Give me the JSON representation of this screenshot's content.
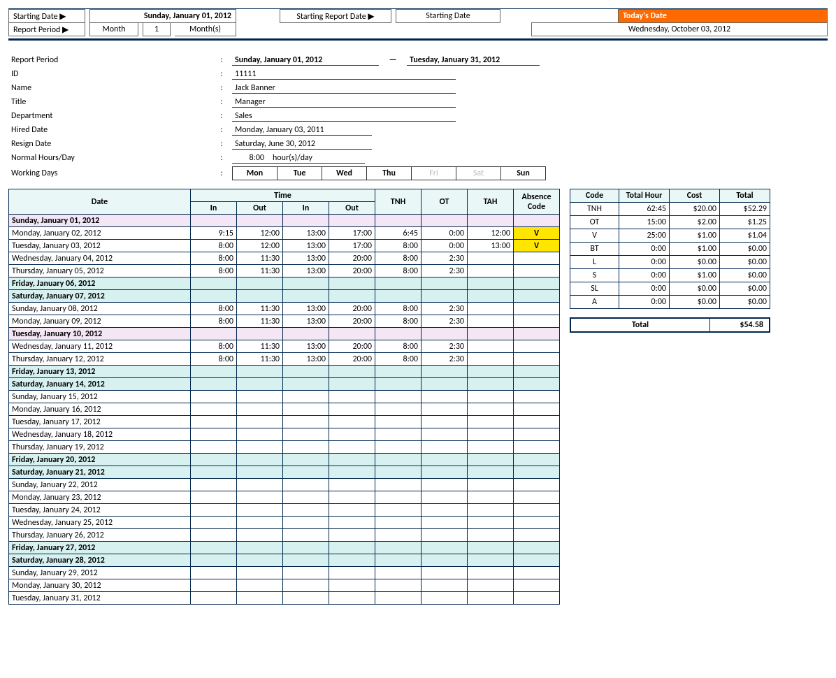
{
  "top": {
    "starting_date_label": "Starting Date ▶",
    "starting_date_value": "Sunday, January 01, 2012",
    "report_period_label": "Report Period ▶",
    "report_period_unit1": "Month",
    "report_period_qty": "1",
    "report_period_unit2": "Month(s)",
    "starting_report_date_label": "Starting Report Date ▶",
    "starting_report_date_value": "Starting Date",
    "today_header": "Today's Date",
    "today_value": "Wednesday, October 03, 2012"
  },
  "info": {
    "report_period_label": "Report Period",
    "report_period_from": "Sunday, January 01, 2012",
    "report_period_dash": "—",
    "report_period_to": "Tuesday, January 31, 2012",
    "id_label": "ID",
    "id_value": "11111",
    "name_label": "Name",
    "name_value": "Jack Banner",
    "title_label": "Title",
    "title_value": "Manager",
    "dept_label": "Department",
    "dept_value": "Sales",
    "hired_label": "Hired Date",
    "hired_value": "Monday, January 03, 2011",
    "resign_label": "Resign Date",
    "resign_value": "Saturday, June 30, 2012",
    "normal_label": "Normal Hours/Day",
    "normal_value": "8:00",
    "normal_unit": "hour(s)/day",
    "working_days_label": "Working Days",
    "days": [
      {
        "lbl": "Mon",
        "active": true
      },
      {
        "lbl": "Tue",
        "active": true
      },
      {
        "lbl": "Wed",
        "active": true
      },
      {
        "lbl": "Thu",
        "active": true
      },
      {
        "lbl": "Fri",
        "active": false
      },
      {
        "lbl": "Sat",
        "active": false
      },
      {
        "lbl": "Sun",
        "active": true
      }
    ]
  },
  "tt_headers": {
    "date": "Date",
    "time": "Time",
    "in": "In",
    "out": "Out",
    "tnh": "TNH",
    "ot": "OT",
    "tah": "TAH",
    "absence": "Absence Code"
  },
  "tt_rows": [
    {
      "type": "pink",
      "date": "Sunday, January 01, 2012"
    },
    {
      "type": "data",
      "date": "Monday, January 02, 2012",
      "in1": "9:15",
      "out1": "12:00",
      "in2": "13:00",
      "out2": "17:00",
      "tnh": "6:45",
      "ot": "0:00",
      "tah": "12:00",
      "code": "V",
      "hl": true
    },
    {
      "type": "data",
      "date": "Tuesday, January 03, 2012",
      "in1": "8:00",
      "out1": "12:00",
      "in2": "13:00",
      "out2": "17:00",
      "tnh": "8:00",
      "ot": "0:00",
      "tah": "13:00",
      "code": "V",
      "hl": true
    },
    {
      "type": "data",
      "date": "Wednesday, January 04, 2012",
      "in1": "8:00",
      "out1": "11:30",
      "in2": "13:00",
      "out2": "20:00",
      "tnh": "8:00",
      "ot": "2:30"
    },
    {
      "type": "data",
      "date": "Thursday, January 05, 2012",
      "in1": "8:00",
      "out1": "11:30",
      "in2": "13:00",
      "out2": "20:00",
      "tnh": "8:00",
      "ot": "2:30"
    },
    {
      "type": "blue",
      "date": "Friday, January 06, 2012"
    },
    {
      "type": "blue",
      "date": "Saturday, January 07, 2012"
    },
    {
      "type": "data",
      "date": "Sunday, January 08, 2012",
      "in1": "8:00",
      "out1": "11:30",
      "in2": "13:00",
      "out2": "20:00",
      "tnh": "8:00",
      "ot": "2:30"
    },
    {
      "type": "data",
      "date": "Monday, January 09, 2012",
      "in1": "8:00",
      "out1": "11:30",
      "in2": "13:00",
      "out2": "20:00",
      "tnh": "8:00",
      "ot": "2:30"
    },
    {
      "type": "pink",
      "date": "Tuesday, January 10, 2012"
    },
    {
      "type": "data",
      "date": "Wednesday, January 11, 2012",
      "in1": "8:00",
      "out1": "11:30",
      "in2": "13:00",
      "out2": "20:00",
      "tnh": "8:00",
      "ot": "2:30"
    },
    {
      "type": "data",
      "date": "Thursday, January 12, 2012",
      "in1": "8:00",
      "out1": "11:30",
      "in2": "13:00",
      "out2": "20:00",
      "tnh": "8:00",
      "ot": "2:30"
    },
    {
      "type": "blue",
      "date": "Friday, January 13, 2012"
    },
    {
      "type": "blue",
      "date": "Saturday, January 14, 2012"
    },
    {
      "type": "data",
      "date": "Sunday, January 15, 2012"
    },
    {
      "type": "data",
      "date": "Monday, January 16, 2012"
    },
    {
      "type": "data",
      "date": "Tuesday, January 17, 2012"
    },
    {
      "type": "data",
      "date": "Wednesday, January 18, 2012"
    },
    {
      "type": "data",
      "date": "Thursday, January 19, 2012"
    },
    {
      "type": "blue",
      "date": "Friday, January 20, 2012"
    },
    {
      "type": "blue",
      "date": "Saturday, January 21, 2012"
    },
    {
      "type": "data",
      "date": "Sunday, January 22, 2012"
    },
    {
      "type": "data",
      "date": "Monday, January 23, 2012"
    },
    {
      "type": "data",
      "date": "Tuesday, January 24, 2012"
    },
    {
      "type": "data",
      "date": "Wednesday, January 25, 2012"
    },
    {
      "type": "data",
      "date": "Thursday, January 26, 2012"
    },
    {
      "type": "blue",
      "date": "Friday, January 27, 2012"
    },
    {
      "type": "blue",
      "date": "Saturday, January 28, 2012"
    },
    {
      "type": "data",
      "date": "Sunday, January 29, 2012"
    },
    {
      "type": "data",
      "date": "Monday, January 30, 2012"
    },
    {
      "type": "data",
      "date": "Tuesday, January 31, 2012"
    }
  ],
  "summary": {
    "headers": {
      "code": "Code",
      "th": "Total Hour",
      "cost": "Cost",
      "total": "Total"
    },
    "rows": [
      {
        "code": "TNH",
        "th": "62:45",
        "cost": "$20.00",
        "total": "$52.29"
      },
      {
        "code": "OT",
        "th": "15:00",
        "cost": "$2.00",
        "total": "$1.25"
      },
      {
        "code": "V",
        "th": "25:00",
        "cost": "$1.00",
        "total": "$1.04"
      },
      {
        "code": "BT",
        "th": "0:00",
        "cost": "$1.00",
        "total": "$0.00"
      },
      {
        "code": "L",
        "th": "0:00",
        "cost": "$0.00",
        "total": "$0.00"
      },
      {
        "code": "S",
        "th": "0:00",
        "cost": "$1.00",
        "total": "$0.00"
      },
      {
        "code": "SL",
        "th": "0:00",
        "cost": "$0.00",
        "total": "$0.00"
      },
      {
        "code": "A",
        "th": "0:00",
        "cost": "$0.00",
        "total": "$0.00"
      }
    ],
    "grand_label": "Total",
    "grand_value": "$54.58"
  }
}
